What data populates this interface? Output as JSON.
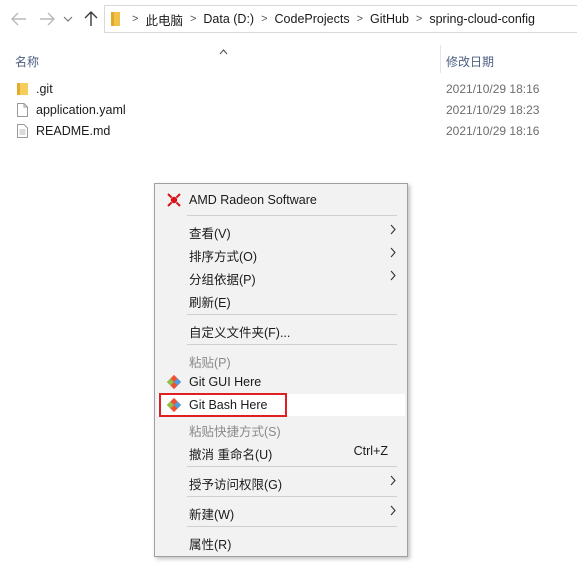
{
  "nav": {
    "back_icon": "back-arrow-icon",
    "forward_icon": "forward-arrow-icon",
    "recent_icon": "chevron-down-icon",
    "up_icon": "up-arrow-icon"
  },
  "address_bar": {
    "crumbs": [
      "此电脑",
      "Data (D:)",
      "CodeProjects",
      "GitHub",
      "spring-cloud-config"
    ]
  },
  "columns": {
    "name": "名称",
    "date": "修改日期"
  },
  "files": [
    {
      "name": ".git",
      "date": "2021/10/29 18:16",
      "icon": "folder-icon"
    },
    {
      "name": "application.yaml",
      "date": "2021/10/29 18:23",
      "icon": "file-icon"
    },
    {
      "name": "README.md",
      "date": "2021/10/29 18:16",
      "icon": "text-file-icon"
    }
  ],
  "context_menu": {
    "amd": "AMD Radeon Software",
    "view": "查看(V)",
    "sort": "排序方式(O)",
    "group": "分组依据(P)",
    "refresh": "刷新(E)",
    "customize": "自定义文件夹(F)...",
    "paste": "粘贴(P)",
    "git_gui": "Git GUI Here",
    "git_bash": "Git Bash Here",
    "paste_shortcut": "粘贴快捷方式(S)",
    "undo": "撤消 重命名(U)",
    "undo_shortcut": "Ctrl+Z",
    "access": "授予访问权限(G)",
    "new": "新建(W)",
    "properties": "属性(R)"
  },
  "colors": {
    "highlight_border": "#e02020",
    "menu_bg": "#f2f2f2",
    "folder": "#f0c24a",
    "amd_red": "#d7141a",
    "git_orange": "#f05133"
  }
}
